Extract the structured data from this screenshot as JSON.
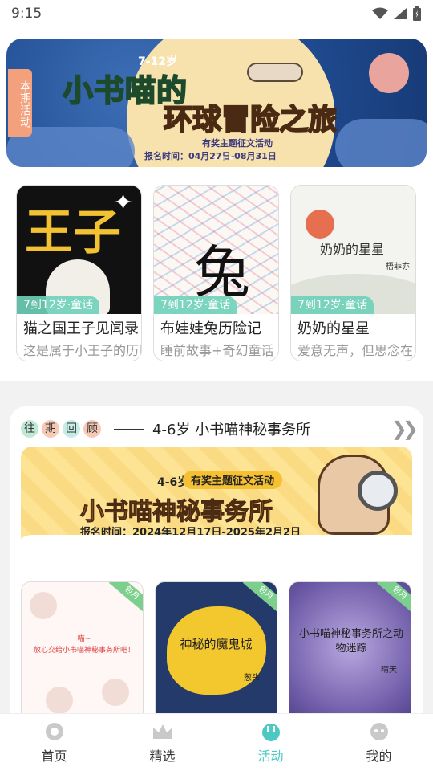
{
  "status": {
    "time": "9:15"
  },
  "banner": {
    "badge": "本期活动",
    "age": "7-12岁",
    "title1": "小书喵的",
    "title2": "环球冒险之旅",
    "subtitle": "有奖主题征文活动",
    "date": "报名时间：04月27日-08月31日"
  },
  "books": [
    {
      "tag": "7到12岁·童话",
      "title": "猫之国王子见闻录",
      "desc": "这是属于小王子的历险",
      "cover_text": "王子"
    },
    {
      "tag": "7到12岁·童话",
      "title": "布娃娃兔历险记",
      "desc": "睡前故事+奇幻童话",
      "cover_text": "兔"
    },
    {
      "tag": "7到12岁·童话",
      "title": "奶奶的星星",
      "desc": "爱意无声，但思念在",
      "cover_text": "奶奶的星星",
      "cover_author": "梧菲亦"
    }
  ],
  "past": {
    "chips": [
      "往",
      "期",
      "回",
      "顾"
    ],
    "chip_colors": [
      "#bfe9d6",
      "#f6c9b6",
      "#c7ece8",
      "#f6c9b6"
    ],
    "title": "4-6岁 小书喵神秘事务所",
    "promo": {
      "age": "4-6岁",
      "pill": "有奖主题征文活动",
      "title": "小书喵神秘事务所",
      "date": "报名时间：2024年12月17日-2025年2月2日"
    },
    "books": [
      {
        "ribbon": "包月",
        "text": "喵~\n放心交给小书喵神秘事务所吧！",
        "author": ""
      },
      {
        "ribbon": "包月",
        "text": "神秘的魔鬼城",
        "author": "葱头"
      },
      {
        "ribbon": "包月",
        "text": "小书喵神秘事务所之动物迷踪",
        "author": "晴天"
      }
    ]
  },
  "tabs": [
    {
      "label": "首页",
      "icon": "home-icon"
    },
    {
      "label": "精选",
      "icon": "crown-icon"
    },
    {
      "label": "活动",
      "icon": "activity-icon",
      "active": true
    },
    {
      "label": "我的",
      "icon": "profile-icon"
    }
  ],
  "colors": {
    "accent": "#4cc9c2",
    "tag": "#6ed2b9"
  }
}
